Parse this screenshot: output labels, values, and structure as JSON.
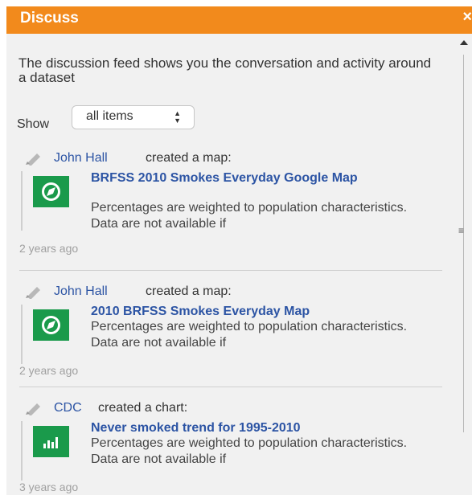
{
  "header": {
    "title": "Discuss",
    "close_glyph": "×"
  },
  "intro": "The discussion feed shows you the conversation and activity around a dataset",
  "filter": {
    "label": "Show",
    "selected": "all items"
  },
  "feed": [
    {
      "author": "John Hall",
      "action": "created a map:",
      "icon": "map-compass-icon",
      "title": "BRFSS 2010 Smokes Everyday Google Map",
      "description": "Percentages are weighted to population characteristics. Data are not available if",
      "time": "2 years ago"
    },
    {
      "author": "John Hall",
      "action": "created a map:",
      "icon": "map-compass-icon",
      "title": "2010 BRFSS Smokes Everyday Map",
      "description": "Percentages are weighted to population characteristics. Data are not available if",
      "time": "2 years ago"
    },
    {
      "author": "CDC",
      "action": "created a chart:",
      "icon": "bar-chart-icon",
      "title": "Never smoked trend for 1995-2010",
      "description": "Percentages are weighted to population characteristics. Data are not available if",
      "time": "3 years ago"
    }
  ],
  "colors": {
    "header": "#f28a1c",
    "link": "#2c54a4",
    "icon_bg": "#1a9a4b"
  }
}
